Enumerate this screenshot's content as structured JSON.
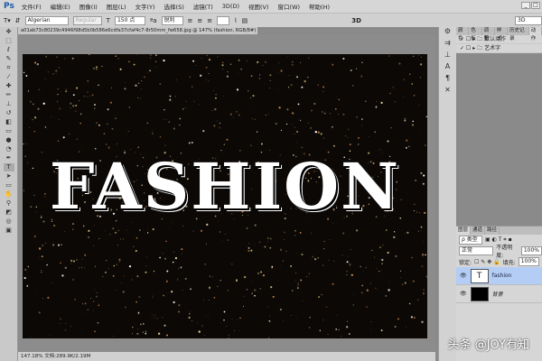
{
  "app": {
    "logo": "Ps"
  },
  "menu": [
    "文件(F)",
    "编辑(E)",
    "图像(I)",
    "图层(L)",
    "文字(Y)",
    "选择(S)",
    "滤镜(T)",
    "3D(D)",
    "视图(V)",
    "窗口(W)",
    "帮助(H)"
  ],
  "options": {
    "font": "Algerian",
    "style": "Regular",
    "size": "150 点",
    "aa": "锐利",
    "mode3d": "3D",
    "workspace": "3D"
  },
  "document": {
    "tab": "a01ab73c80239c4946f98d5b0b586e6cdfa37cfaf4c7-8r50mm_fw658.jpg @ 147% (fashion, RGB/8#) *",
    "text": "FASHION",
    "status": "147.18%     文档:289.9K/2.19M"
  },
  "actions": {
    "tabs": [
      "颜色",
      "色板",
      "调整",
      "样式",
      "历史记录",
      "动作"
    ],
    "items": [
      "默认动作",
      "艺术字"
    ]
  },
  "layers": {
    "tabs": [
      "图层",
      "通道",
      "路径"
    ],
    "filter": "ρ 类型",
    "blend": "正常",
    "opacity_label": "不透明度:",
    "opacity": "100%",
    "lock_label": "锁定:",
    "fill_label": "填充:",
    "fill": "100%",
    "items": [
      {
        "name": "fashion",
        "thumb": "T"
      },
      {
        "name": "背景",
        "thumb": ""
      }
    ]
  },
  "watermark": "头条 @JOY有知"
}
